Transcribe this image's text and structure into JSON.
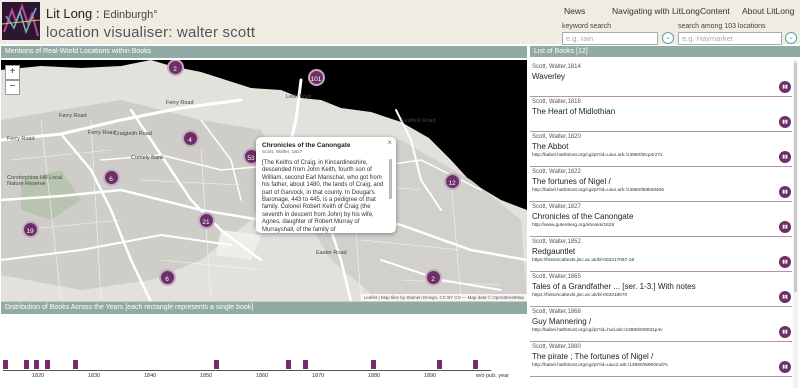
{
  "header": {
    "app_name": "Lit Long",
    "city": "Edinburgh",
    "page_title": "location visualiser: walter scott",
    "nav": [
      "News",
      "Navigating with LitLong",
      "Content",
      "About LitLong"
    ]
  },
  "search": {
    "keyword_label": "keyword search",
    "keyword_placeholder": "e.g. rain",
    "location_label": "search among 103 locations",
    "location_placeholder": "e.g. Haymarket",
    "button_icon": "chevron-down-icon"
  },
  "sections": {
    "map_heading": "Mentions of Real-World Locations within Books",
    "list_heading": "List of Books [12]",
    "timeline_heading": "Distribution of Books Across the Years [each rectangle represents a single book]"
  },
  "map": {
    "zoom_in": "+",
    "zoom_out": "−",
    "road_labels": [
      "Ferry Road",
      "Ferry Road",
      "Ferry Road",
      "Ferry Road",
      "Leith Walk",
      "Easter Road",
      "Seafield Road",
      "Craigleith Road",
      "Comely Bank",
      "Corstorphine Hill Local Nature Reserve"
    ],
    "clusters": [
      "2",
      "101",
      "4",
      "53",
      "6",
      "12",
      "21",
      "19",
      "6",
      "2"
    ],
    "attribution": "Leaflet | Map tiles by Stamen Design, CC BY 3.0 — Map data © OpenStreetMap",
    "colors": {
      "cluster": "#6d2f66",
      "water": "#000000",
      "land": "#e5e3df"
    }
  },
  "popup": {
    "close": "×",
    "title": "Chronicles of the Canongate",
    "meta": "Scott, Walter, 1827",
    "body": "[The Keiths of Craig, in Kincardineshire, descended from John Keith, fourth son of William, second Earl Marischal, who got from his father, about 1480, the lands of Craig, and part of Garvock, in that county. In Dougal's Baronage, 443 to 445, is a pedigree of that family. Colonel Robert Keith of Craig (the seventh in descent from John) by his wife, Agnes, daughter of Robert Murray of Murrayshall, of the family of"
  },
  "timeline": {
    "axis_labels": [
      "1820",
      "1830",
      "1840",
      "1850",
      "1860",
      "1870",
      "1880",
      "1890",
      "w/o pub. year"
    ],
    "books_per_year": [
      1814,
      1818,
      1820,
      1822,
      1827,
      1852,
      1865,
      1868,
      1880
    ],
    "colors": {
      "mark": "#7a2b6e"
    }
  },
  "books": [
    {
      "meta": "Scott, Walter,1814",
      "title": "Waverley",
      "link": ""
    },
    {
      "meta": "Scott, Walter,1818",
      "title": "The Heart of Midlothian",
      "link": ""
    },
    {
      "meta": "Scott, Walter,1820",
      "title": "The Abbot",
      "link": "http://babel.hathitrust.org/cgi/pt?id=uiuo.ark:/13960/t0cp4r27x"
    },
    {
      "meta": "Scott, Walter,1822",
      "title": "The fortunes of Nigel /",
      "link": "http://babel.hathitrust.org/cgi/pt?id=uiuo.ark:/13960/t89k58406"
    },
    {
      "meta": "Scott, Walter,1827",
      "title": "Chronicles of the Canongate",
      "link": "http://www.gutenberg.org/ebooks/1628"
    },
    {
      "meta": "Scott, Walter,1852",
      "title": "Redgauntlet",
      "link": "https://historicaltexts.jisc.ac.uk/bl-003317067-18"
    },
    {
      "meta": "Scott, Walter,1865",
      "title": "Tales of a Grandfather ... [ser. 1-3.] With notes",
      "link": "https://historicaltexts.jisc.ac.uk/bl-003318070"
    },
    {
      "meta": "Scott, Walter,1868",
      "title": "Guy Mannering /",
      "link": "http://babel.hathitrust.org/cgi/pt?id=hvd.ark:/13960/t09031p4v"
    },
    {
      "meta": "Scott, Walter,1880",
      "title": "The pirate ; The fortunes of Nigel /",
      "link": "http://babel.hathitrust.org/cgi/pt?id=uiuc2.ark:/13960/t6960md7s"
    }
  ],
  "book_button_icon": "book-icon"
}
